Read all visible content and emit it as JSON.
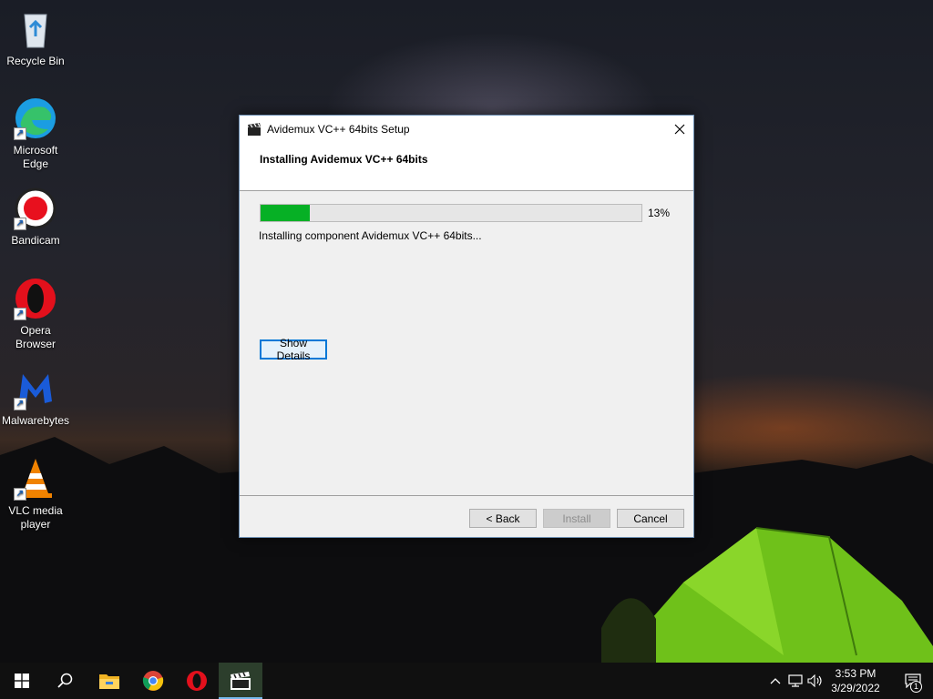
{
  "desktop": {
    "icons": [
      {
        "label": "Recycle Bin",
        "icon": "recycle-bin-icon"
      },
      {
        "label": "Microsoft Edge",
        "icon": "edge-icon"
      },
      {
        "label": "Bandicam",
        "icon": "bandicam-icon"
      },
      {
        "label": "Opera Browser",
        "icon": "opera-icon"
      },
      {
        "label": "Malwarebytes",
        "icon": "malwarebytes-icon"
      },
      {
        "label": "VLC media player",
        "icon": "vlc-icon"
      }
    ]
  },
  "dialog": {
    "title": "Avidemux VC++ 64bits Setup",
    "heading": "Installing Avidemux VC++ 64bits",
    "progress_percent": 13,
    "progress_label": "13%",
    "status": "Installing component Avidemux VC++ 64bits...",
    "show_details_label": "Show Details",
    "back_label": "< Back",
    "install_label": "Install",
    "cancel_label": "Cancel",
    "progress_color": "#06b025"
  },
  "taskbar": {
    "items": [
      "start-icon",
      "search-icon",
      "file-explorer-icon",
      "chrome-icon",
      "opera-icon",
      "avidemux-icon"
    ],
    "time": "3:53 PM",
    "date": "3/29/2022",
    "notification_count": "1"
  }
}
